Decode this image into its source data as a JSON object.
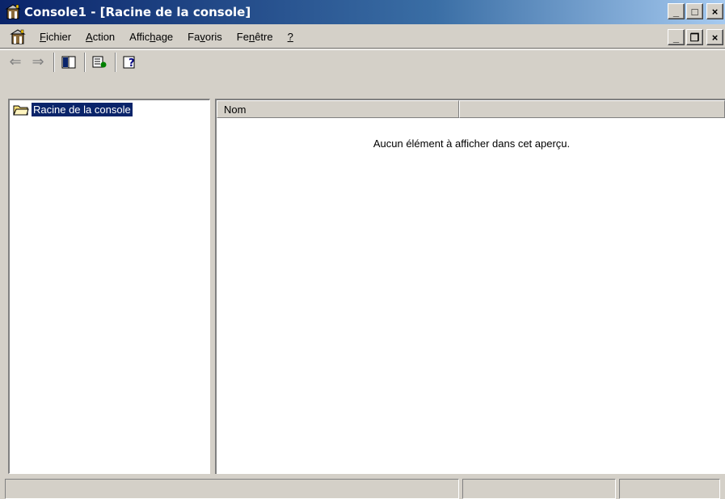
{
  "window": {
    "title": "Console1 - [Racine de la console]",
    "controls": {
      "minimize": "_",
      "maximize": "□",
      "close": "×"
    }
  },
  "menubar": {
    "items": [
      {
        "label": "Fichier",
        "mnemonic": "F",
        "rest": "ichier"
      },
      {
        "label": "Action",
        "mnemonic": "A",
        "rest": "ction"
      },
      {
        "pre": "Affic",
        "mnemonic": "h",
        "rest": "age",
        "label": "Affichage"
      },
      {
        "pre": "Fa",
        "mnemonic": "v",
        "rest": "oris",
        "label": "Favoris"
      },
      {
        "pre": "Fe",
        "mnemonic": "n",
        "rest": "être",
        "label": "Fenêtre"
      },
      {
        "label": "?",
        "mnemonic": "?",
        "rest": ""
      }
    ],
    "mdi_controls": {
      "minimize": "_",
      "restore": "❐",
      "close": "×"
    }
  },
  "toolbar": {
    "buttons": [
      {
        "name": "back-arrow-icon",
        "glyph": "⇐",
        "enabled": false
      },
      {
        "name": "forward-arrow-icon",
        "glyph": "⇒",
        "enabled": false
      },
      {
        "name": "show-hide-tree-icon",
        "glyph": "▥",
        "enabled": true
      },
      {
        "name": "export-list-icon",
        "glyph": "▤",
        "enabled": true
      },
      {
        "name": "help-icon",
        "glyph": "?",
        "enabled": true
      }
    ]
  },
  "tree": {
    "root_label": "Racine de la console"
  },
  "list": {
    "columns": [
      "Nom",
      ""
    ],
    "empty_message": "Aucun élément à afficher dans cet aperçu."
  },
  "colors": {
    "title_gradient_start": "#0a246a",
    "title_gradient_end": "#a6caf0",
    "selection": "#0a246a",
    "face": "#d4d0c8"
  }
}
